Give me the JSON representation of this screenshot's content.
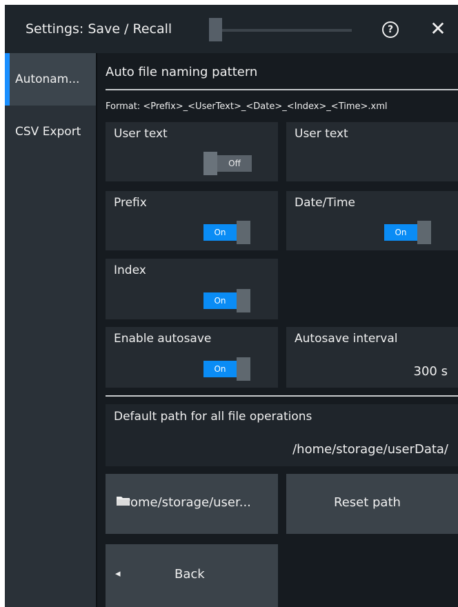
{
  "window": {
    "title": "Settings: Save / Recall",
    "help_glyph": "?",
    "close_glyph": "✕"
  },
  "nav": {
    "tabs": [
      {
        "label": "Autonam...",
        "active": true
      },
      {
        "label": "CSV Export",
        "active": false
      }
    ]
  },
  "section": {
    "title": "Auto file naming pattern",
    "format": "Format: <Prefix>_<UserText>_<Date>_<Index>_<Time>.xml"
  },
  "user_text_toggle": {
    "label": "User text",
    "state": "Off"
  },
  "user_text_value": {
    "label": "User text",
    "value": ""
  },
  "prefix": {
    "label": "Prefix",
    "state": "On"
  },
  "datetime": {
    "label": "Date/Time",
    "state": "On"
  },
  "index": {
    "label": "Index",
    "state": "On"
  },
  "autosave": {
    "label": "Enable autosave",
    "state": "On"
  },
  "autosave_interval": {
    "label": "Autosave interval",
    "value": "300 s"
  },
  "default_path": {
    "label": "Default path for all file operations",
    "value": "/home/storage/userData/"
  },
  "buttons": {
    "browse": "ome/storage/user...",
    "reset": "Reset path",
    "back": "Back",
    "back_glyph": "◂"
  },
  "colors": {
    "accent": "#0a8cf5",
    "background": "#161b20",
    "card": "#252b31",
    "button": "#3b434a"
  },
  "icons": [
    "help-icon",
    "close-icon",
    "folder-icon",
    "back-arrow-icon"
  ]
}
